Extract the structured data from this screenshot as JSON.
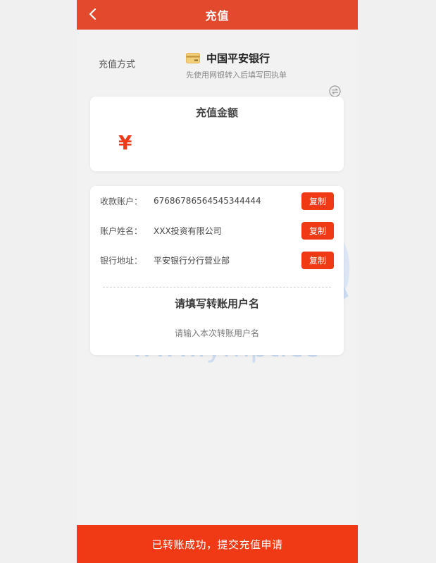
{
  "header": {
    "title": "充值"
  },
  "method": {
    "label": "充值方式",
    "bank_name": "中国平安银行",
    "hint": "先使用网银转入后填写回执单"
  },
  "amount": {
    "title": "充值金额",
    "currency_symbol": "¥",
    "value": "",
    "placeholder": ""
  },
  "account": {
    "rows": [
      {
        "label": "收款账户：",
        "value": "67686786564545344444",
        "copy_label": "复制"
      },
      {
        "label": "账户姓名：",
        "value": "XXX投资有限公司",
        "copy_label": "复制"
      },
      {
        "label": "银行地址：",
        "value": "平安银行分行营业部",
        "copy_label": "复制"
      }
    ],
    "transfer_title": "请填写转账用户名",
    "transfer_placeholder": "请输入本次转账用户名"
  },
  "watermark": {
    "text": "源码平台",
    "url": "www.ympt.cc"
  },
  "footer": {
    "submit_label": "已转账成功，提交充值申请"
  },
  "colors": {
    "header_bg": "#e2492d",
    "accent": "#f03a16",
    "page_bg": "#f2f2f2"
  }
}
